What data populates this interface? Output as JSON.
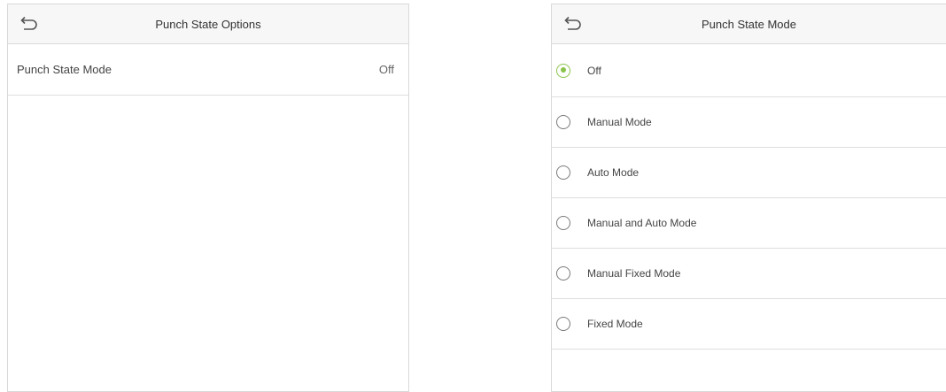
{
  "left_screen": {
    "title": "Punch State Options",
    "items": [
      {
        "label": "Punch State Mode",
        "value": "Off"
      }
    ]
  },
  "right_screen": {
    "title": "Punch State Mode",
    "selected_color": "#8bc34a",
    "options": [
      {
        "label": "Off",
        "selected": true
      },
      {
        "label": "Manual Mode",
        "selected": false
      },
      {
        "label": "Auto Mode",
        "selected": false
      },
      {
        "label": "Manual and Auto Mode",
        "selected": false
      },
      {
        "label": "Manual Fixed Mode",
        "selected": false
      },
      {
        "label": "Fixed Mode",
        "selected": false
      }
    ]
  }
}
